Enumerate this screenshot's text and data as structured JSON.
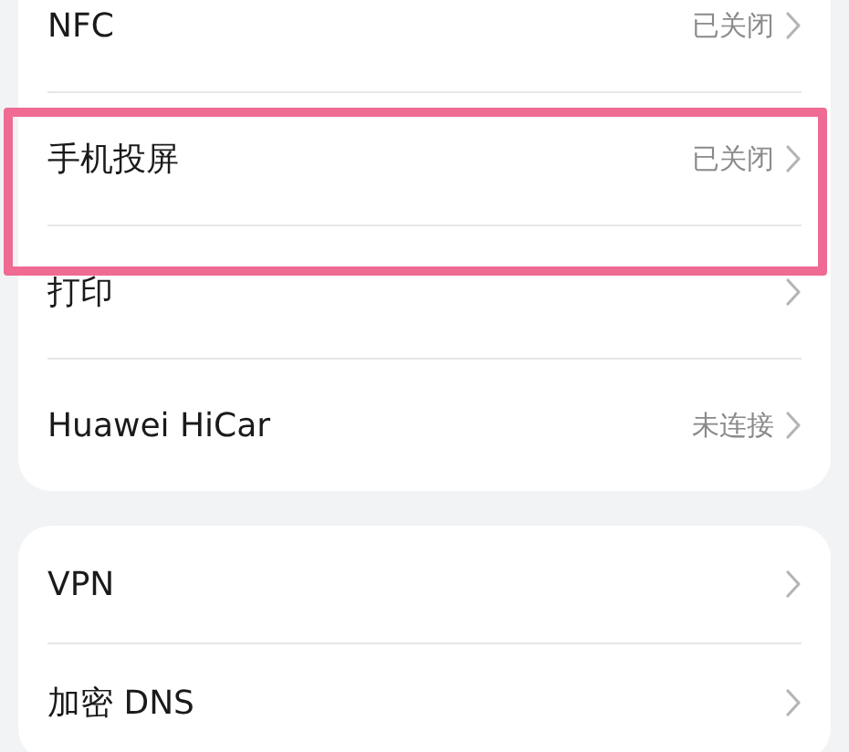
{
  "groups": [
    {
      "rows": [
        {
          "label": "NFC",
          "value": "已关闭",
          "highlighted": false
        },
        {
          "label": "手机投屏",
          "value": "已关闭",
          "highlighted": true
        },
        {
          "label": "打印",
          "highlighted": false
        },
        {
          "label": "Huawei HiCar",
          "value": "未连接",
          "highlighted": false
        }
      ]
    },
    {
      "rows": [
        {
          "label": "VPN",
          "highlighted": false
        },
        {
          "label": "加密 DNS",
          "highlighted": false
        }
      ]
    }
  ]
}
